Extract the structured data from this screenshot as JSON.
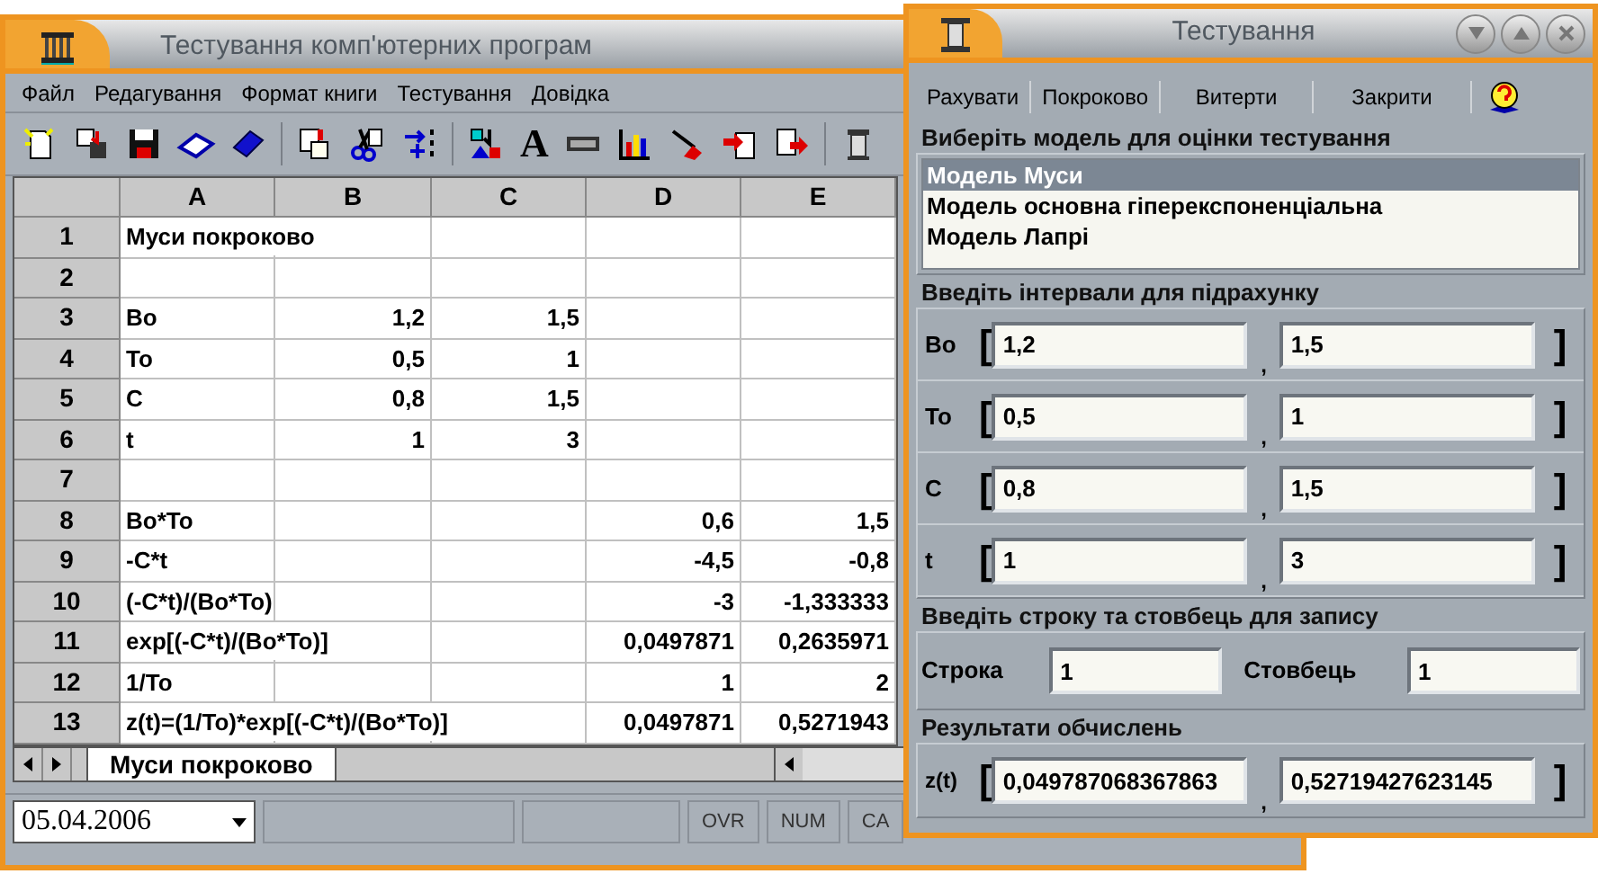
{
  "main_window": {
    "title": "Тестування комп'ютерних програм",
    "menu": [
      "Файл",
      "Редагування",
      "Формат книги",
      "Тестування",
      "Довідка"
    ],
    "toolbar": {
      "font_label": "A"
    },
    "sheet": {
      "columns": [
        "A",
        "B",
        "C",
        "D",
        "E"
      ],
      "rows": [
        {
          "number": "1",
          "A": "Муси покроково"
        },
        {
          "number": "2"
        },
        {
          "number": "3",
          "A": "Bo",
          "B": "1,2",
          "C": "1,5"
        },
        {
          "number": "4",
          "A": "To",
          "B": "0,5",
          "C": "1"
        },
        {
          "number": "5",
          "A": "C",
          "B": "0,8",
          "C": "1,5"
        },
        {
          "number": "6",
          "A": "t",
          "B": "1",
          "C": "3"
        },
        {
          "number": "7"
        },
        {
          "number": "8",
          "A": "Bo*To",
          "D": "0,6",
          "E": "1,5"
        },
        {
          "number": "9",
          "A": "-C*t",
          "D": "-4,5",
          "E": "-0,8"
        },
        {
          "number": "10",
          "A": "(-C*t)/(Bo*To)",
          "D": "-3",
          "E": "-1,333333"
        },
        {
          "number": "11",
          "A": "exp[(-C*t)/(Bo*To)]",
          "D": "0,0497871",
          "E": "0,2635971"
        },
        {
          "number": "12",
          "A": "1/To",
          "D": "1",
          "E": "2"
        },
        {
          "number": "13",
          "A": "z(t)=(1/To)*exp[(-C*t)/(Bo*To)]",
          "D": "0,0497871",
          "E": "0,5271943"
        }
      ]
    },
    "sheet_tabs": [
      {
        "label": "Муси покроково",
        "selected": true
      }
    ],
    "status_bar": {
      "date": "05.04.2006",
      "indicators": [
        "OVR",
        "NUM",
        "CA"
      ]
    }
  },
  "dialog": {
    "title": "Тестування",
    "menu": [
      "Рахувати",
      "Покроково",
      "Витерти",
      "Закрити"
    ],
    "model_group": {
      "title": "Виберіть модель для оцінки тестування",
      "models": [
        {
          "label": "Модель Муси",
          "selected": true
        },
        {
          "label": "Модель основна гіперекспоненціальна",
          "selected": false
        },
        {
          "label": "Модель Лапрі",
          "selected": false
        }
      ]
    },
    "interval_group": {
      "title": "Введіть інтервали  для  підрахунку",
      "open_bracket": "[",
      "close_bracket": "]",
      "separator": ",",
      "rows": [
        {
          "label": "Bo",
          "from": "1,2",
          "to": "1,5"
        },
        {
          "label": "To",
          "from": "0,5",
          "to": "1"
        },
        {
          "label": "C",
          "from": "0,8",
          "to": "1,5"
        },
        {
          "label": "t",
          "from": "1",
          "to": "3"
        }
      ]
    },
    "position_group": {
      "title": "Введіть строку та стовбець для запису",
      "row_label": "Строка",
      "row_value": "1",
      "column_label": "Стовбець",
      "column_value": "1"
    },
    "results_group": {
      "title": "Результати обчислень",
      "label": "z(t)",
      "open_bracket": "[",
      "close_bracket": "]",
      "separator": ",",
      "from": "0,049787068367863",
      "to": "0,52719427623145"
    }
  }
}
